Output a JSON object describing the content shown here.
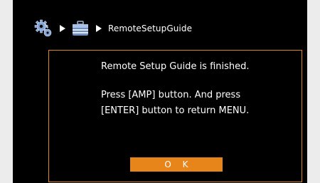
{
  "breadcrumb": {
    "icons": [
      "settings-gears-icon",
      "toolbox-icon"
    ],
    "separator": "play-triangle-icon",
    "current": "RemoteSetupGuide"
  },
  "dialog": {
    "title": "Remote Setup Guide is finished.",
    "line1": "Press [AMP] button. And press",
    "line2": "[ENTER] button to return MENU.",
    "ok_label": "O K"
  },
  "colors": {
    "background": "#000000",
    "accent": "#e8851a",
    "frame": "#ececec"
  }
}
